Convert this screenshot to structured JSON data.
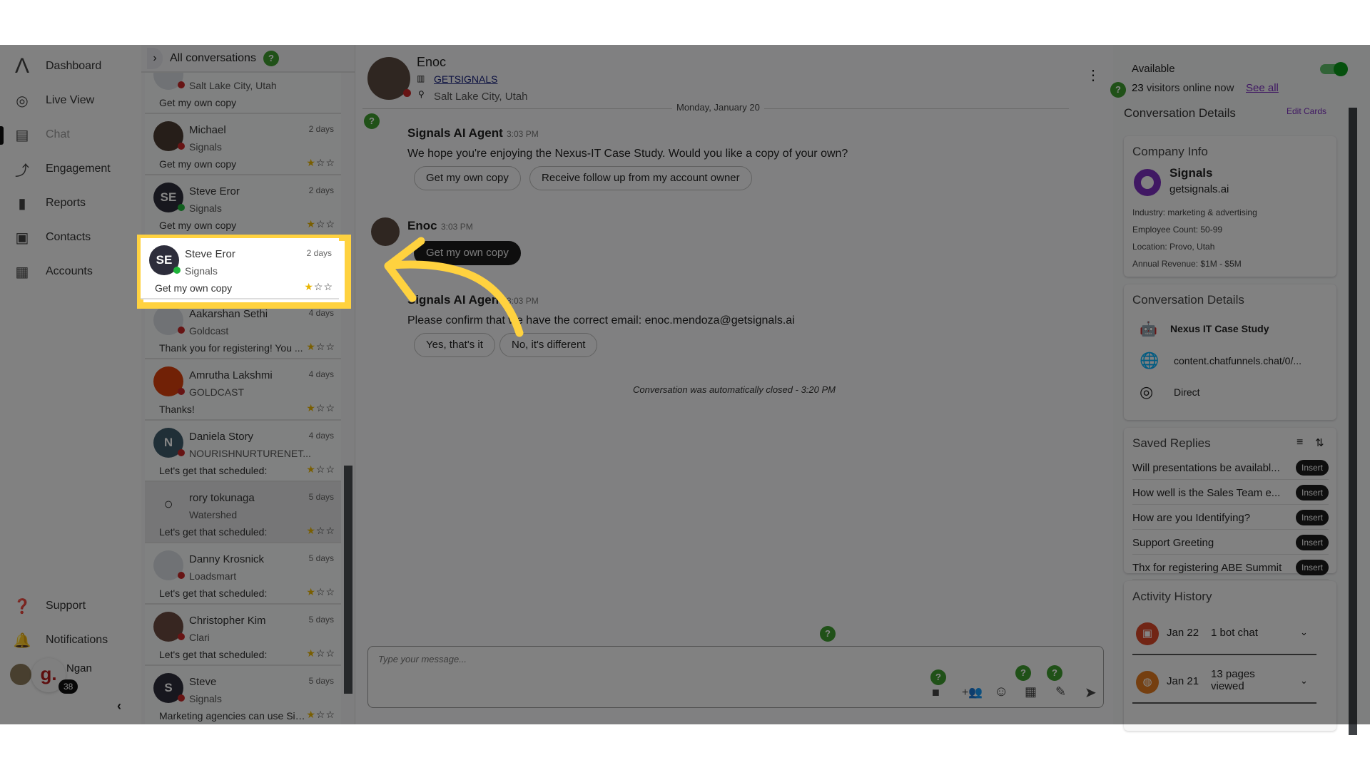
{
  "sidebar": {
    "items": [
      {
        "label": "Dashboard",
        "icon": "logo-icon"
      },
      {
        "label": "Live View",
        "icon": "live-view-icon"
      },
      {
        "label": "Chat",
        "icon": "chat-icon",
        "active": true
      },
      {
        "label": "Engagement",
        "icon": "engagement-icon"
      },
      {
        "label": "Reports",
        "icon": "bar-chart-icon"
      },
      {
        "label": "Contacts",
        "icon": "contacts-icon"
      },
      {
        "label": "Accounts",
        "icon": "building-icon"
      }
    ],
    "support": "Support",
    "notifications": "Notifications",
    "user": {
      "name": "Ngan",
      "badge": "38",
      "logo_letter": "g."
    }
  },
  "conversations": {
    "header": "All conversations",
    "items": [
      {
        "name": "",
        "company": "Salt Lake City, Utah",
        "time": "",
        "preview": "Get my own copy",
        "rating": 0,
        "status": "offline"
      },
      {
        "name": "Michael",
        "company": "Signals",
        "time": "2 days",
        "preview": "Get my own copy",
        "rating": 1,
        "status": "offline"
      },
      {
        "name": "Steve Eror",
        "initials": "SE",
        "company": "Signals",
        "time": "2 days",
        "preview": "Get my own copy",
        "rating": 1,
        "status": "online"
      },
      {
        "name": "Steve Eror",
        "initials": "SE",
        "company": "Signals",
        "time": "2 days",
        "preview": "Get my own copy",
        "rating": 1,
        "status": "online",
        "selected": true
      },
      {
        "name": "Aakarshan Sethi",
        "company": "Goldcast",
        "time": "4 days",
        "preview": "Thank you for registering! You ...",
        "rating": 1,
        "status": "offline"
      },
      {
        "name": "Amrutha Lakshmi",
        "company": "GOLDCAST",
        "time": "4 days",
        "preview": "Thanks!",
        "rating": 1,
        "status": "offline"
      },
      {
        "name": "Daniela Story",
        "initials": "N",
        "company": "NOURISHNURTURENET...",
        "time": "4 days",
        "preview": "Let's get that scheduled:",
        "rating": 1,
        "status": "offline"
      },
      {
        "name": "rory tokunaga",
        "company": "Watershed",
        "time": "5 days",
        "preview": "Let's get that scheduled:",
        "rating": 1,
        "status": "none"
      },
      {
        "name": "Danny Krosnick",
        "company": "Loadsmart",
        "time": "5 days",
        "preview": "Let's get that scheduled:",
        "rating": 1,
        "status": "offline"
      },
      {
        "name": "Christopher Kim",
        "company": "Clari",
        "time": "5 days",
        "preview": "Let's get that scheduled:",
        "rating": 1,
        "status": "offline"
      },
      {
        "name": "Steve",
        "initials": "S",
        "company": "Signals",
        "time": "5 days",
        "preview": "Marketing agencies can use Sig...",
        "rating": 1,
        "status": "offline"
      }
    ]
  },
  "chat": {
    "contact": {
      "name": "Enoc",
      "company": "GETSIGNALS",
      "location": "Salt Lake City, Utah"
    },
    "date_divider": "Monday, January 20",
    "messages": [
      {
        "sender": "Signals AI Agent",
        "time": "3:03 PM",
        "text": "We hope you're enjoying the Nexus-IT Case Study. Would you like a copy of your own?",
        "options": [
          "Get my own copy",
          "Receive follow up from my account owner"
        ]
      },
      {
        "sender": "Enoc",
        "time": "3:03 PM",
        "text": "Get my own copy"
      },
      {
        "sender": "Signals AI Agent",
        "time": "3:03 PM",
        "text": "Please confirm that we have the correct email: enoc.mendoza@getsignals.ai",
        "options": [
          "Yes, that's it",
          "No, it's different"
        ]
      }
    ],
    "closed_notice": "Conversation was automatically closed - 3:20 PM",
    "composer_placeholder": "Type your message..."
  },
  "right": {
    "availability": "Available",
    "available_on": true,
    "visitors_count": "23",
    "visitors_text": "visitors online now",
    "see_all": "See all",
    "section_title": "Conversation Details",
    "edit_cards": "Edit Cards",
    "company_info": {
      "title": "Company Info",
      "name": "Signals",
      "domain": "getsignals.ai",
      "industry": "Industry: marketing & advertising",
      "employees": "Employee Count: 50-99",
      "location": "Location: Provo, Utah",
      "revenue": "Annual Revenue: $1M - $5M"
    },
    "conversation_details": {
      "title": "Conversation Details",
      "campaign": "Nexus IT Case Study",
      "url": "content.chatfunnels.chat/0/...",
      "source": "Direct"
    },
    "saved_replies": {
      "title": "Saved Replies",
      "insert_label": "Insert",
      "items": [
        "Will presentations be availabl...",
        "How well is the Sales Team e...",
        "How are you Identifying?",
        "Support Greeting",
        "Thx for registering ABE Summit"
      ]
    },
    "activity": {
      "title": "Activity History",
      "items": [
        {
          "date": "Jan 22",
          "text": "1 bot chat",
          "icon": "robot-icon"
        },
        {
          "date": "Jan 21",
          "text": "13 pages viewed",
          "icon": "globe-icon"
        }
      ]
    }
  },
  "colors": {
    "highlight": "#ffd23f",
    "online": "#1fb43a",
    "offline": "#c62828",
    "accent": "#7b2fbe",
    "help": "#3e9b2e"
  }
}
